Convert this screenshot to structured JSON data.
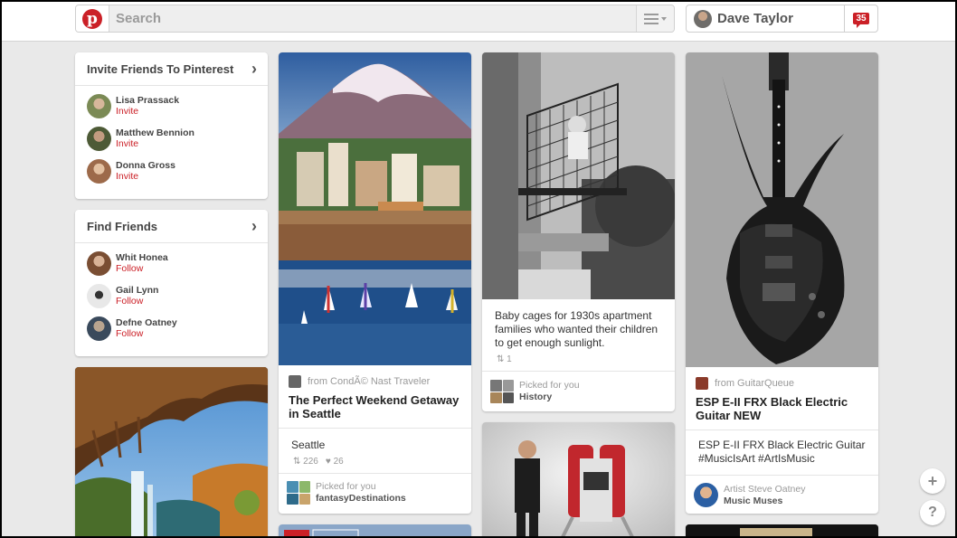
{
  "header": {
    "search_placeholder": "Search",
    "user_name": "Dave Taylor",
    "notification_count": "35"
  },
  "invite_friends": {
    "title": "Invite Friends To Pinterest",
    "people": [
      {
        "name": "Lisa Prassack",
        "action": "Invite"
      },
      {
        "name": "Matthew Bennion",
        "action": "Invite"
      },
      {
        "name": "Donna Gross",
        "action": "Invite"
      }
    ]
  },
  "find_friends": {
    "title": "Find Friends",
    "people": [
      {
        "name": "Whit Honea",
        "action": "Follow"
      },
      {
        "name": "Gail Lynn",
        "action": "Follow"
      },
      {
        "name": "Defne Oatney",
        "action": "Follow"
      }
    ]
  },
  "pins": {
    "seattle": {
      "source": "from CondÃ© Nast Traveler",
      "title": "The Perfect Weekend Getaway in Seattle",
      "description": "Seattle",
      "repins": "226",
      "likes": "26",
      "picked_label": "Picked for you",
      "board": "fantasyDestinations"
    },
    "baby": {
      "description": "Baby cages for 1930s apartment families who wanted their children to get enough sunlight.",
      "repins": "1",
      "picked_label": "Picked for you",
      "board": "History"
    },
    "guitar": {
      "source": "from GuitarQueue",
      "title": "ESP E-II FRX Black Electric Guitar NEW",
      "description": "ESP E-II FRX Black Electric Guitar #MusicIsArt #ArtIsMusic",
      "artist": "Artist Steve Oatney",
      "board": "Music Muses"
    }
  },
  "floating": {
    "add": "+",
    "help": "?"
  },
  "colors": {
    "brand_red": "#cb2027",
    "background": "#e9e9e9"
  }
}
